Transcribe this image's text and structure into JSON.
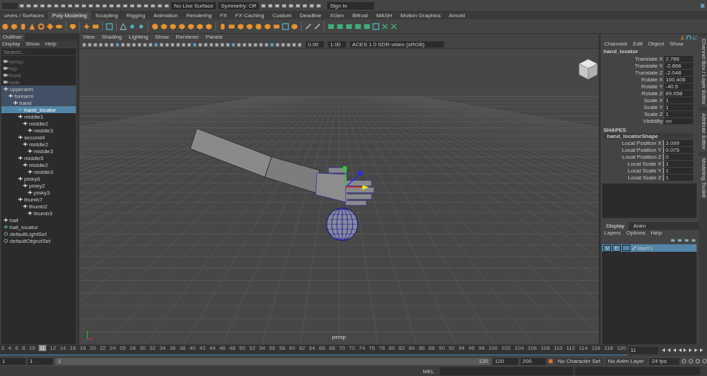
{
  "status_line": {
    "live_surface": "No Live Surface",
    "symmetry": "Symmetry: Off",
    "sign_in": "Sign In"
  },
  "shelf_tabs": [
    {
      "label": "urves / Surfaces",
      "selected": false
    },
    {
      "label": "Poly Modeling",
      "selected": true
    },
    {
      "label": "Sculpting",
      "selected": false
    },
    {
      "label": "Rigging",
      "selected": false
    },
    {
      "label": "Animation",
      "selected": false
    },
    {
      "label": "Rendering",
      "selected": false
    },
    {
      "label": "FX",
      "selected": false
    },
    {
      "label": "FX Caching",
      "selected": false
    },
    {
      "label": "Custom",
      "selected": false
    },
    {
      "label": "Deadline",
      "selected": false
    },
    {
      "label": "XGen",
      "selected": false
    },
    {
      "label": "Bifrost",
      "selected": false
    },
    {
      "label": "MASH",
      "selected": false
    },
    {
      "label": "Motion Graphics",
      "selected": false
    },
    {
      "label": "Arnold",
      "selected": false
    }
  ],
  "outliner": {
    "title": "Outliner",
    "menu": [
      "Display",
      "Show",
      "Help"
    ],
    "search": {
      "placeholder": "Search..."
    },
    "items": [
      {
        "label": "persp",
        "kind": "camera",
        "selected": false,
        "highlighted": false
      },
      {
        "label": "top",
        "kind": "camera",
        "selected": false,
        "highlighted": false
      },
      {
        "label": "front",
        "kind": "camera",
        "selected": false,
        "highlighted": false
      },
      {
        "label": "side",
        "kind": "camera",
        "selected": false,
        "highlighted": false
      },
      {
        "label": "upperarm",
        "kind": "joint",
        "selected": false,
        "highlighted": true,
        "children": [
          {
            "label": "forearm",
            "kind": "joint",
            "selected": false,
            "highlighted": true,
            "children": [
              {
                "label": "hand",
                "kind": "joint",
                "selected": false,
                "highlighted": true,
                "children": [
                  {
                    "label": "hand_locator",
                    "kind": "locator",
                    "selected": true,
                    "highlighted": false
                  },
                  {
                    "label": "middle1",
                    "kind": "joint",
                    "selected": false,
                    "highlighted": false,
                    "children": [
                      {
                        "label": "middle2",
                        "kind": "joint",
                        "selected": false,
                        "highlighted": false,
                        "children": [
                          {
                            "label": "middle3",
                            "kind": "joint",
                            "selected": false,
                            "highlighted": false
                          }
                        ]
                      }
                    ]
                  },
                  {
                    "label": "second4",
                    "kind": "joint",
                    "selected": false,
                    "highlighted": false,
                    "children": [
                      {
                        "label": "middle2",
                        "kind": "joint",
                        "selected": false,
                        "highlighted": false,
                        "children": [
                          {
                            "label": "middle3",
                            "kind": "joint",
                            "selected": false,
                            "highlighted": false
                          }
                        ]
                      }
                    ]
                  },
                  {
                    "label": "middle5",
                    "kind": "joint",
                    "selected": false,
                    "highlighted": false,
                    "children": [
                      {
                        "label": "middle2",
                        "kind": "joint",
                        "selected": false,
                        "highlighted": false,
                        "children": [
                          {
                            "label": "middle3",
                            "kind": "joint",
                            "selected": false,
                            "highlighted": false
                          }
                        ]
                      }
                    ]
                  },
                  {
                    "label": "pinky6",
                    "kind": "joint",
                    "selected": false,
                    "highlighted": false,
                    "children": [
                      {
                        "label": "pinky2",
                        "kind": "joint",
                        "selected": false,
                        "highlighted": false,
                        "children": [
                          {
                            "label": "pinky3",
                            "kind": "joint",
                            "selected": false,
                            "highlighted": false
                          }
                        ]
                      }
                    ]
                  },
                  {
                    "label": "thumb7",
                    "kind": "joint",
                    "selected": false,
                    "highlighted": false,
                    "children": [
                      {
                        "label": "thumb2",
                        "kind": "joint",
                        "selected": false,
                        "highlighted": false,
                        "children": [
                          {
                            "label": "thumb3",
                            "kind": "joint",
                            "selected": false,
                            "highlighted": false
                          }
                        ]
                      }
                    ]
                  }
                ]
              }
            ]
          }
        ]
      },
      {
        "label": "ball",
        "kind": "joint",
        "selected": false,
        "highlighted": false
      },
      {
        "label": "ball_locator",
        "kind": "locator",
        "selected": false,
        "highlighted": false
      },
      {
        "label": "defaultLightSet",
        "kind": "set",
        "selected": false,
        "highlighted": false
      },
      {
        "label": "defaultObjectSet",
        "kind": "set",
        "selected": false,
        "highlighted": false
      }
    ]
  },
  "viewport": {
    "menu": [
      "View",
      "Shading",
      "Lighting",
      "Show",
      "Renderer",
      "Panels"
    ],
    "exposure": "0.00",
    "gamma": "1.00",
    "color_space": "ACES 1.0 SDR-video (sRGB)",
    "camera_label": "persp"
  },
  "channel_box": {
    "menu": [
      "Channels",
      "Edit",
      "Object",
      "Show"
    ],
    "object": "hand_locator",
    "channels": [
      {
        "name": "Translate X",
        "value": "2.786"
      },
      {
        "name": "Translate Y",
        "value": "-2.866"
      },
      {
        "name": "Translate Z",
        "value": "-2.048"
      },
      {
        "name": "Rotate X",
        "value": "100.406"
      },
      {
        "name": "Rotate Y",
        "value": "-40.5"
      },
      {
        "name": "Rotate Z",
        "value": "89.958"
      },
      {
        "name": "Scale X",
        "value": "1"
      },
      {
        "name": "Scale Y",
        "value": "1"
      },
      {
        "name": "Scale Z",
        "value": "1"
      },
      {
        "name": "Visibility",
        "value": "on"
      }
    ],
    "shapes_header": "SHAPES",
    "shape_name": "hand_locatorShape",
    "shape_channels": [
      {
        "name": "Local Position X",
        "value": "3.099"
      },
      {
        "name": "Local Position Y",
        "value": "0.075"
      },
      {
        "name": "Local Position Z",
        "value": "0"
      },
      {
        "name": "Local Scale X",
        "value": "1"
      },
      {
        "name": "Local Scale Y",
        "value": "1"
      },
      {
        "name": "Local Scale Z",
        "value": "1"
      }
    ]
  },
  "layer_editor": {
    "tabs": [
      {
        "label": "Display",
        "selected": true
      },
      {
        "label": "Anim",
        "selected": false
      }
    ],
    "menu": [
      "Layers",
      "Options",
      "Help"
    ],
    "layers": [
      {
        "visible": "V",
        "playback": "P",
        "name": "layer1",
        "selected": true
      }
    ]
  },
  "side_tabs": [
    "Channel Box / Layer Editor",
    "Attribute Editor",
    "Modeling Toolkit"
  ],
  "timeline": {
    "ticks": [
      {
        "label": "2",
        "selected": false
      },
      {
        "label": "4",
        "selected": false
      },
      {
        "label": "6",
        "selected": false
      },
      {
        "label": "8",
        "selected": false
      },
      {
        "label": "10",
        "selected": false
      },
      {
        "label": "11",
        "selected": true
      },
      {
        "label": "12",
        "selected": false
      },
      {
        "label": "14",
        "selected": false
      },
      {
        "label": "16",
        "selected": false
      },
      {
        "label": "18",
        "selected": false
      },
      {
        "label": "20",
        "selected": false
      },
      {
        "label": "22",
        "selected": false
      },
      {
        "label": "24",
        "selected": false
      },
      {
        "label": "26",
        "selected": false
      },
      {
        "label": "28",
        "selected": false
      },
      {
        "label": "30",
        "selected": false
      },
      {
        "label": "32",
        "selected": false
      },
      {
        "label": "34",
        "selected": false
      },
      {
        "label": "36",
        "selected": false
      },
      {
        "label": "38",
        "selected": false
      },
      {
        "label": "40",
        "selected": false
      },
      {
        "label": "42",
        "selected": false
      },
      {
        "label": "44",
        "selected": false
      },
      {
        "label": "46",
        "selected": false
      },
      {
        "label": "48",
        "selected": false
      },
      {
        "label": "50",
        "selected": false
      },
      {
        "label": "52",
        "selected": false
      },
      {
        "label": "54",
        "selected": false
      },
      {
        "label": "56",
        "selected": false
      },
      {
        "label": "58",
        "selected": false
      },
      {
        "label": "60",
        "selected": false
      },
      {
        "label": "62",
        "selected": false
      },
      {
        "label": "64",
        "selected": false
      },
      {
        "label": "66",
        "selected": false
      },
      {
        "label": "68",
        "selected": false
      },
      {
        "label": "70",
        "selected": false
      },
      {
        "label": "72",
        "selected": false
      },
      {
        "label": "74",
        "selected": false
      },
      {
        "label": "76",
        "selected": false
      },
      {
        "label": "78",
        "selected": false
      },
      {
        "label": "80",
        "selected": false
      },
      {
        "label": "82",
        "selected": false
      },
      {
        "label": "84",
        "selected": false
      },
      {
        "label": "86",
        "selected": false
      },
      {
        "label": "88",
        "selected": false
      },
      {
        "label": "90",
        "selected": false
      },
      {
        "label": "92",
        "selected": false
      },
      {
        "label": "94",
        "selected": false
      },
      {
        "label": "96",
        "selected": false
      },
      {
        "label": "98",
        "selected": false
      },
      {
        "label": "100",
        "selected": false
      },
      {
        "label": "102",
        "selected": false
      },
      {
        "label": "104",
        "selected": false
      },
      {
        "label": "106",
        "selected": false
      },
      {
        "label": "108",
        "selected": false
      },
      {
        "label": "110",
        "selected": false
      },
      {
        "label": "112",
        "selected": false
      },
      {
        "label": "114",
        "selected": false
      },
      {
        "label": "116",
        "selected": false
      },
      {
        "label": "118",
        "selected": false
      },
      {
        "label": "120",
        "selected": false
      }
    ],
    "current_frame": "11"
  },
  "range": {
    "start": "1",
    "range_start": "1",
    "range_bar_start": "1",
    "range_bar_end": "120",
    "range_end": "120",
    "anim_end": "200",
    "character_set": "No Character Set",
    "anim_layer": "No Anim Layer",
    "fps": "24 fps"
  },
  "command_line": {
    "language": "MEL"
  }
}
